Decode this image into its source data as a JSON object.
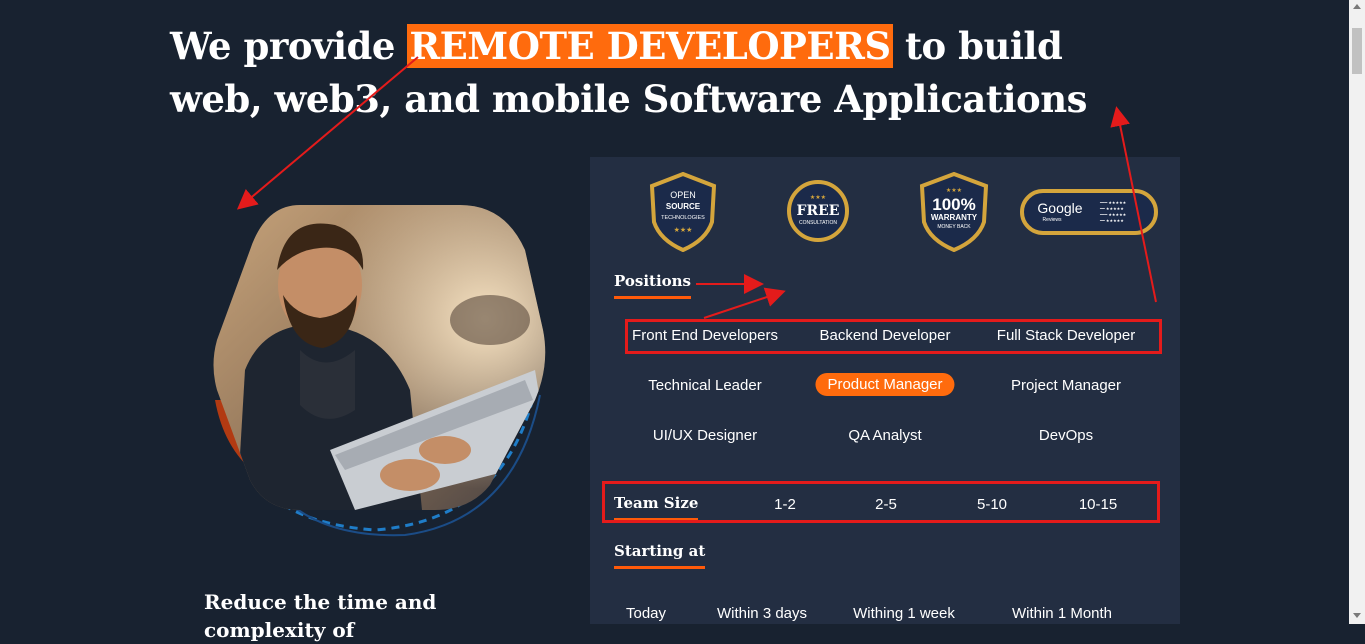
{
  "hero": {
    "prefix": "We provide ",
    "highlight": "REMOTE DEVELOPERS",
    "suffix": " to build web, web3, and mobile Software Applications"
  },
  "badges": {
    "open_source": [
      "OPEN",
      "SOURCE",
      "TECHNOLOGIES"
    ],
    "free": [
      "FREE",
      "CONSULTATION"
    ],
    "warranty": [
      "100%",
      "WARRANTY",
      "MONEY BACK"
    ],
    "google": [
      "Google",
      "Reviews"
    ]
  },
  "positions": {
    "title": "Positions",
    "items": [
      "Front End Developers",
      "Backend Developer",
      "Full Stack Developer",
      "Technical Leader",
      "Product Manager",
      "Project Manager",
      "UI/UX Designer",
      "QA Analyst",
      "DevOps"
    ],
    "selected": "Product Manager"
  },
  "team_size": {
    "title": "Team Size",
    "options": [
      "1-2",
      "2-5",
      "5-10",
      "10-15"
    ]
  },
  "starting": {
    "title": "Starting at",
    "options": [
      "Today",
      "Within 3 days",
      "Withing 1 week",
      "Within 1 Month"
    ]
  },
  "left_text": "Reduce the time and complexity of",
  "colors": {
    "accent": "#ff6b0d",
    "background": "#182230",
    "panel": "#232e42",
    "annotation": "#e41b1b",
    "gold": "#d4a53c"
  }
}
